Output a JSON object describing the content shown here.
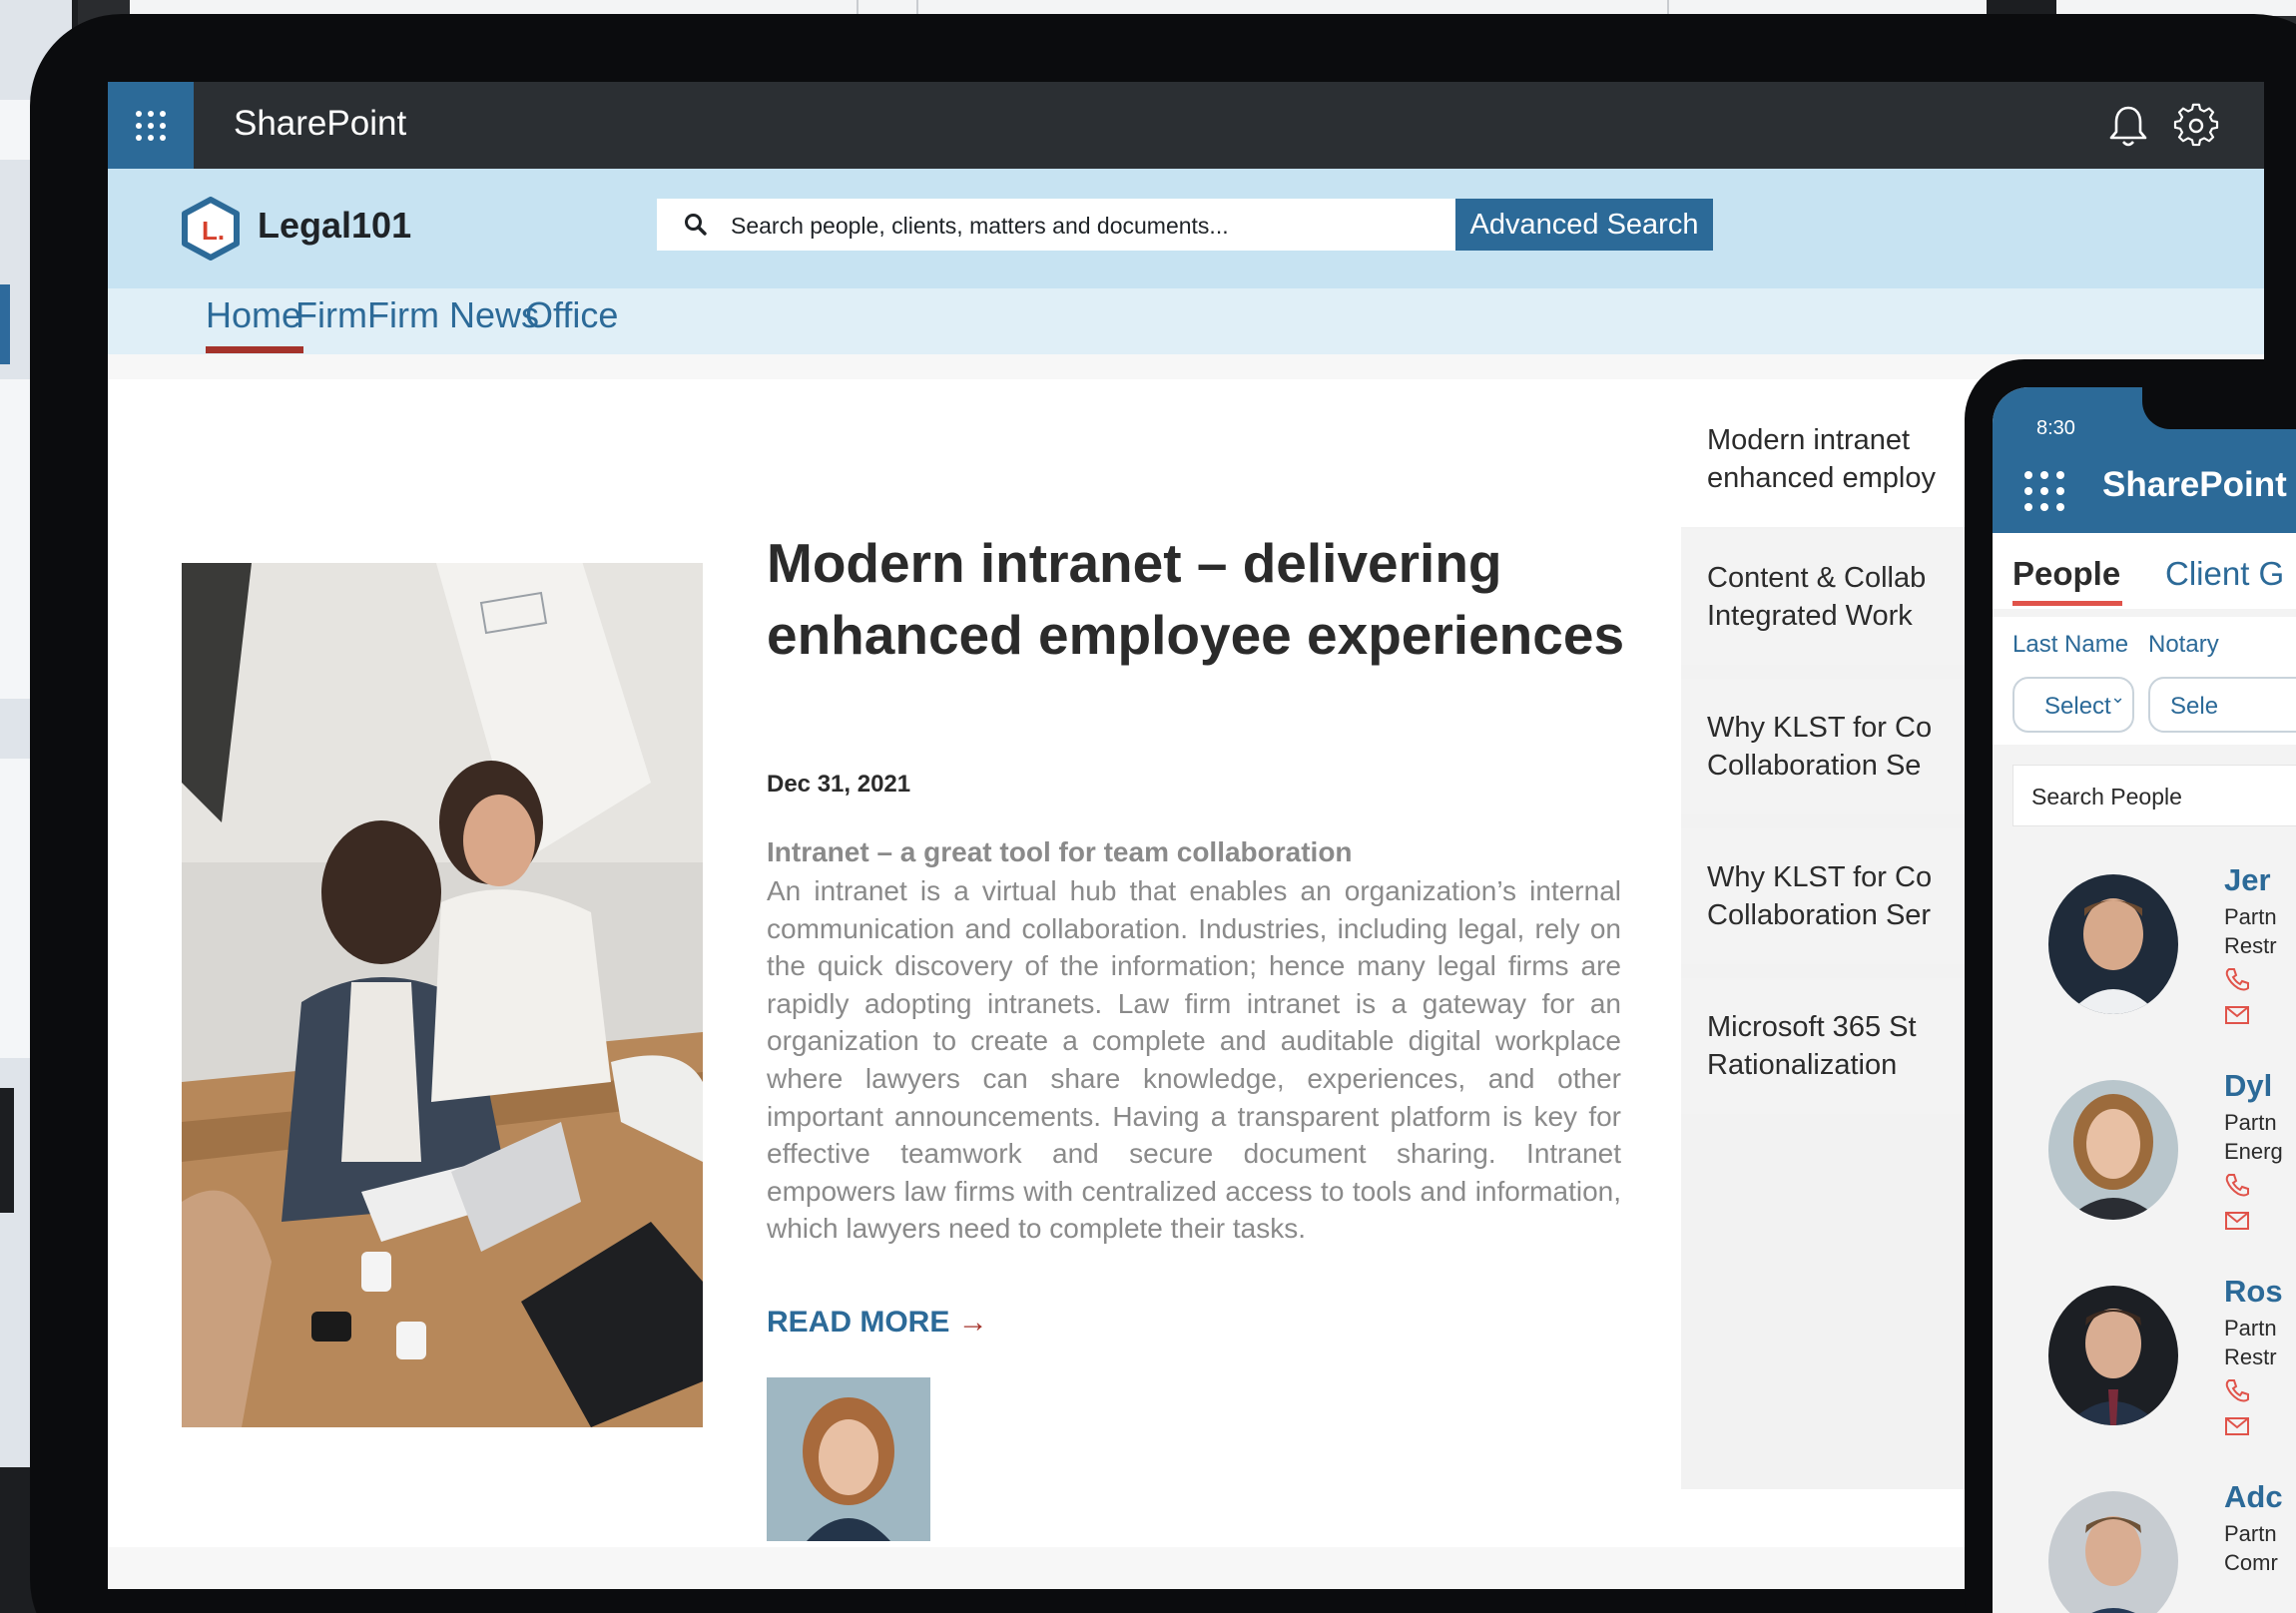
{
  "app": {
    "title": "SharePoint"
  },
  "topbar": {
    "icons": [
      "waffle-icon",
      "bell-icon",
      "gear-icon"
    ]
  },
  "brand": {
    "name": "Legal101",
    "logo_letter": "L."
  },
  "search": {
    "placeholder": "Search people, clients, matters and documents...",
    "advanced_label": "Advanced Search"
  },
  "nav": {
    "items": [
      {
        "label": "Home",
        "active": true
      },
      {
        "label": "Firm",
        "active": false
      },
      {
        "label": "Firm News",
        "active": false
      },
      {
        "label": "Office",
        "active": false
      }
    ]
  },
  "article": {
    "title": "Modern intranet – delivering enhanced employee experiences",
    "date": "Dec 31, 2021",
    "subheading": "Intranet – a great tool for team collaboration",
    "body": "An intranet is a virtual hub that enables an organization’s internal communication and collaboration. Industries, including legal, rely on the quick discovery of the information; hence many legal firms are rapidly adopting intranets. Law firm intranet is a gateway for an organization to create a complete and auditable digital workplace where lawyers can share knowledge, experiences, and other important announcements. Having a transparent platform is key for effective teamwork and secure document sharing. Intranet empowers law firms with centralized access to tools and information, which lawyers need to complete their tasks.",
    "read_more": "READ MORE",
    "read_more_arrow": "→"
  },
  "sidebar": {
    "items": [
      {
        "line1": "Modern intranet",
        "line2": "enhanced employ"
      },
      {
        "line1": "Content & Collab",
        "line2": "Integrated Work"
      },
      {
        "line1": "Why KLST for Co",
        "line2": "Collaboration Se"
      },
      {
        "line1": "Why KLST for Co",
        "line2": "Collaboration Ser"
      },
      {
        "line1": "Microsoft 365 St",
        "line2": "Rationalization"
      }
    ]
  },
  "phone": {
    "time": "8:30",
    "title": "SharePoint",
    "tabs": [
      "People",
      "Client G"
    ],
    "filters": [
      {
        "label": "Last Name",
        "value": "Select",
        "chevron": "⌄"
      },
      {
        "label": "Notary",
        "value": "Sele",
        "chevron": ""
      }
    ],
    "search_placeholder": "Search People",
    "people": [
      {
        "name": "Jer",
        "line1": "Partn",
        "line2": "Restr"
      },
      {
        "name": "Dyl",
        "line1": "Partn",
        "line2": "Energ"
      },
      {
        "name": "Ros",
        "line1": "Partn",
        "line2": "Restr"
      },
      {
        "name": "Adc",
        "line1": "Partn",
        "line2": "Comr"
      }
    ]
  },
  "colors": {
    "accent": "#2c6a98",
    "topbar": "#2b2f33",
    "brandbar": "#c7e3f2",
    "navbar": "#e0eff7",
    "active_underline": "#a4332b",
    "phone_tab_underline": "#e0534a"
  }
}
